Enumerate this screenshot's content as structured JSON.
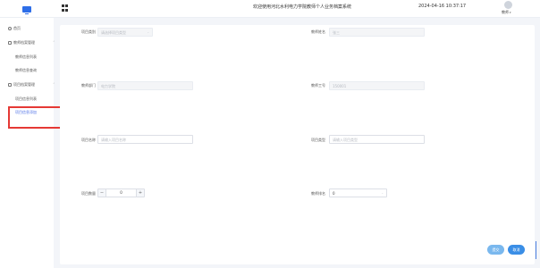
{
  "header": {
    "welcome": "欢迎使用河北水利电力学院教师个人业务档案系统",
    "datetime": "2024-04-16 10:37:17",
    "user_name": "教师",
    "user_caret": "▾"
  },
  "sidebar": {
    "home": "首页",
    "group1": {
      "label": "教师档案管理",
      "chevron": "⌃"
    },
    "sub1": "教师信息列表",
    "sub2": "教师信息查询",
    "group2": {
      "label": "项目档案管理",
      "chevron": "⌃"
    },
    "sub3": "项目信息列表",
    "sub4": "项目信息添加"
  },
  "form": {
    "category_label": "项目类别",
    "category_value": "请选择项目类型",
    "category_dropdown": "⌄",
    "teacher_name_label": "教师姓名",
    "teacher_name_value": "张三",
    "teacher_dept_label": "教师部门",
    "teacher_dept_value": "电力学院",
    "teacher_id_label": "教师工号",
    "teacher_id_value": "150001",
    "project_name_label": "项目名称",
    "project_name_placeholder": "请输入项目名称",
    "project_type_label": "项目类型",
    "project_type_placeholder": "请输入项目类型",
    "count_label": "项目数量",
    "count_minus": "−",
    "count_value": "0",
    "count_plus": "+",
    "rank_label": "教师排名",
    "rank_value": "0",
    "rank_dropdown": "⌄"
  },
  "buttons": {
    "save": "提交",
    "cancel": "取消"
  }
}
